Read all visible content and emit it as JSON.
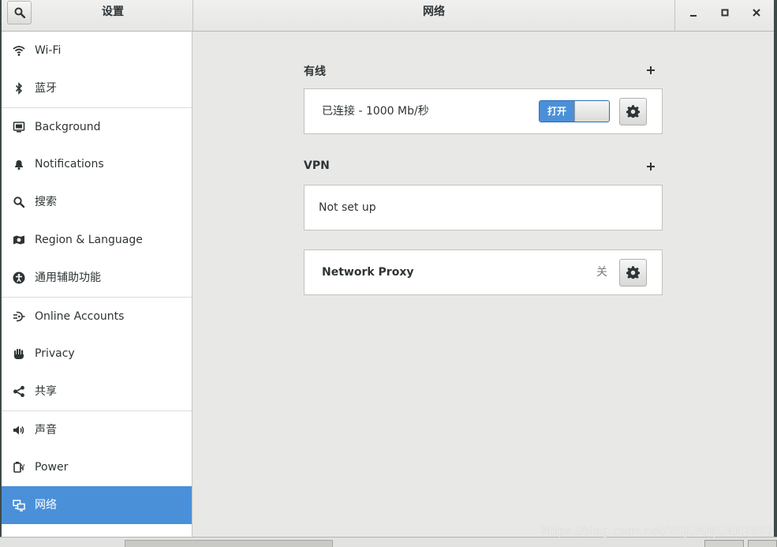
{
  "headerbar": {
    "left_title": "设置",
    "main_title": "网络"
  },
  "sidebar": {
    "items": [
      {
        "label": "Wi-Fi",
        "icon": "wifi-icon"
      },
      {
        "label": "蓝牙",
        "icon": "bluetooth-icon"
      },
      {
        "label": "Background",
        "icon": "background-icon"
      },
      {
        "label": "Notifications",
        "icon": "bell-icon"
      },
      {
        "label": "搜索",
        "icon": "search-icon"
      },
      {
        "label": "Region & Language",
        "icon": "region-icon"
      },
      {
        "label": "通用辅助功能",
        "icon": "accessibility-icon"
      },
      {
        "label": "Online Accounts",
        "icon": "online-accounts-icon"
      },
      {
        "label": "Privacy",
        "icon": "hand-icon"
      },
      {
        "label": "共享",
        "icon": "share-icon"
      },
      {
        "label": "声音",
        "icon": "speaker-icon"
      },
      {
        "label": "Power",
        "icon": "power-plug-icon"
      },
      {
        "label": "网络",
        "icon": "network-icon",
        "active": true
      }
    ]
  },
  "main": {
    "wired": {
      "title": "有线",
      "status": "已连接 - 1000 Mb/秒",
      "toggle_label": "打开"
    },
    "vpn": {
      "title": "VPN",
      "empty_text": "Not set up"
    },
    "proxy": {
      "label": "Network Proxy",
      "status": "关"
    }
  },
  "watermark": "https://blog.csdn.net/XUJUANJUAN2002",
  "colors": {
    "accent": "#4a90d9",
    "sidebar_bg": "#ffffff",
    "content_bg": "#e8e8e7"
  }
}
